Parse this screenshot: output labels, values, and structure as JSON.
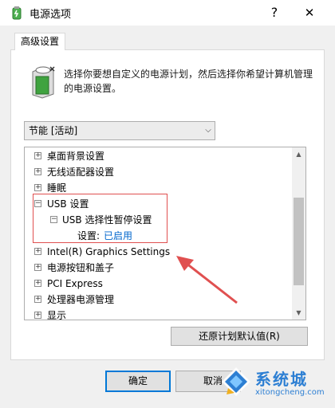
{
  "window": {
    "title": "电源选项",
    "help_glyph": "?",
    "close_glyph": "✕",
    "title_icon": "power-options-icon"
  },
  "tab": {
    "label": "高级设置"
  },
  "description": {
    "line1": "选择你要想自定义的电源计划，然后选择你希望计算机管理",
    "line2": "的电源设置。"
  },
  "plan_select": {
    "value": "节能 [活动]",
    "arrow": "⌵"
  },
  "tree": {
    "items": [
      {
        "expander": "+",
        "label": "桌面背景设置"
      },
      {
        "expander": "+",
        "label": "无线适配器设置"
      },
      {
        "expander": "+",
        "label": "睡眠"
      },
      {
        "expander": "−",
        "label": "USB 设置"
      },
      {
        "expander": "−",
        "label": "USB 选择性暂停设置"
      },
      {
        "expander": "",
        "label": "设置:",
        "value": "已启用"
      },
      {
        "expander": "+",
        "label": "Intel(R) Graphics Settings"
      },
      {
        "expander": "+",
        "label": "电源按钮和盖子"
      },
      {
        "expander": "+",
        "label": "PCI Express"
      },
      {
        "expander": "+",
        "label": "处理器电源管理"
      },
      {
        "expander": "+",
        "label": "显示"
      }
    ]
  },
  "scrollbar": {
    "up_glyph": "▲",
    "down_glyph": "▼"
  },
  "buttons": {
    "restore": "还原计划默认值(R)",
    "ok": "确定",
    "cancel": "取消"
  },
  "watermark": {
    "title": "系统城",
    "url": "xitongcheng.com"
  },
  "colors": {
    "annotation": "#e05050",
    "accent": "#0078d7",
    "value_link": "#0066cc"
  }
}
